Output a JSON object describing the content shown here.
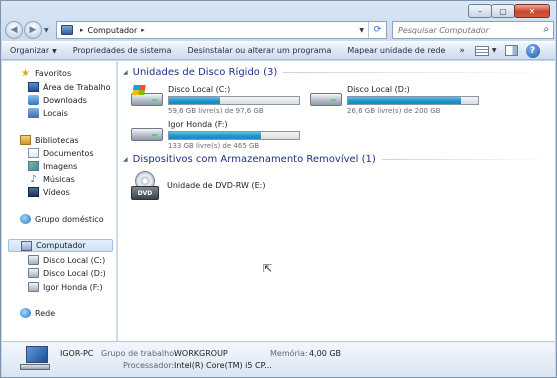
{
  "window": {
    "minimize_glyph": "–",
    "maximize_glyph": "▢",
    "close_glyph": "✕"
  },
  "address": {
    "crumb": "Computador",
    "separator": "▸"
  },
  "search": {
    "placeholder": "Pesquisar Computador"
  },
  "toolbar": {
    "organize": "Organizar",
    "system_properties": "Propriedades de sistema",
    "uninstall": "Desinstalar ou alterar um programa",
    "map_drive": "Mapear unidade de rede",
    "more": "»",
    "help": "?"
  },
  "navpane": {
    "favorites": "Favoritos",
    "desktop": "Área de Trabalho",
    "downloads": "Downloads",
    "places": "Locais",
    "libraries": "Bibliotecas",
    "documents": "Documentos",
    "images": "Imagens",
    "music": "Músicas",
    "videos": "Vídeos",
    "homegroup": "Grupo doméstico",
    "computer": "Computador",
    "drive_c": "Disco Local (C:)",
    "drive_d": "Disco Local (D:)",
    "drive_f": "Igor Honda (F:)",
    "network": "Rede"
  },
  "content": {
    "hdd_group": "Unidades de Disco Rígido (3)",
    "removable_group": "Dispositivos com Armazenamento Removível (1)",
    "drives": [
      {
        "name": "Disco Local (C:)",
        "free": "59,6 GB livre(s) de 97,6 GB",
        "used_fraction": 0.39
      },
      {
        "name": "Disco Local (D:)",
        "free": "26,6 GB livre(s) de 200 GB",
        "used_fraction": 0.87
      },
      {
        "name": "Igor Honda (F:)",
        "free": "133 GB livre(s) de 465 GB",
        "used_fraction": 0.71
      }
    ],
    "dvd": {
      "name": "Unidade de DVD-RW (E:)",
      "badge": "DVD"
    }
  },
  "details": {
    "computer_name": "IGOR-PC",
    "workgroup_label": "Grupo de trabalho:",
    "workgroup_value": "WORKGROUP",
    "memory_label": "Memória:",
    "memory_value": "4,00 GB",
    "processor_label": "Processador:",
    "processor_value": "Intel(R) Core(TM) i5 CP..."
  },
  "colors": {
    "accent": "#1e3287",
    "bar_fill": "#2596cd"
  }
}
